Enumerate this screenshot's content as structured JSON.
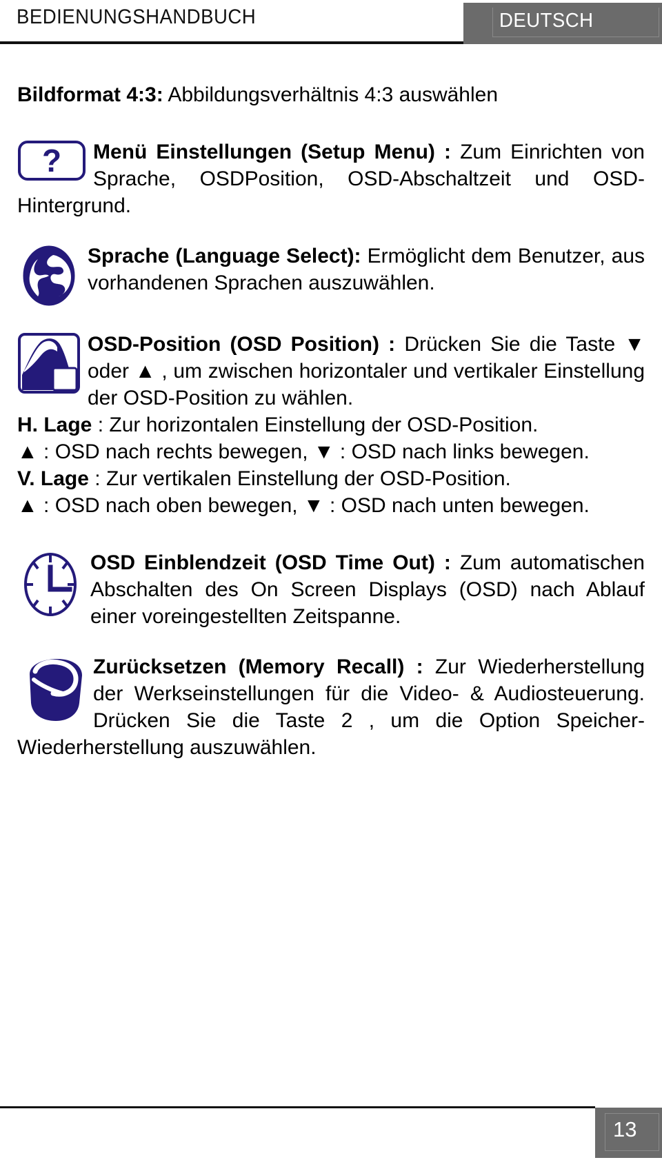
{
  "header": {
    "manual_title": "BEDIENUNGSHANDBUCH",
    "language_badge": "DEUTSCH"
  },
  "footer": {
    "page_number": "13"
  },
  "colors": {
    "icon_navy": "#241a7a",
    "header_gray": "#6b6b6b",
    "rule_black": "#111111",
    "text_black": "#000000"
  },
  "content": {
    "aspect_line": {
      "lead": "Bildformat 4:3:",
      "rest": " Abbildungsverhältnis 4:3 auswählen"
    },
    "setup_menu": {
      "icon": "question-mark-icon",
      "lead": "Menü Einstellungen (Setup Menu)",
      "separator": " : ",
      "body": "Zum Einrichten von Sprache, OSDPosition, OSD-Abschaltzeit und OSD-Hintergrund."
    },
    "language_select": {
      "icon": "globe-icon",
      "lead": "Sprache (Language Select):",
      "body": " Ermöglicht dem Benutzer, aus vorhandenen Sprachen auszuwählen."
    },
    "osd_position": {
      "icon": "osd-position-icon",
      "lead": "OSD-Position (OSD Position)",
      "separator": " : ",
      "body": "Drücken Sie die Taste ▼ oder ▲ , um zwischen horizontaler und vertikaler Einstellung der OSD-Position zu wählen.",
      "h_lage_lead": "H. Lage",
      "h_lage_body": " : Zur horizontalen Einstellung der OSD-Position.",
      "h_lage_keys": "▲ : OSD nach rechts bewegen, ▼ : OSD nach links bewegen.",
      "v_lage_lead": "V. Lage",
      "v_lage_body": " : Zur vertikalen Einstellung der OSD-Position.",
      "v_lage_keys": "▲ : OSD nach oben bewegen, ▼ : OSD nach unten bewegen."
    },
    "osd_time_out": {
      "icon": "clock-icon",
      "lead": "OSD Einblendzeit (OSD Time Out)",
      "separator": " : ",
      "body": "Zum automatischen Abschalten des On Screen Displays (OSD) nach Ablauf einer voreingestellten Zeitspanne."
    },
    "memory_recall": {
      "icon": "bucket-icon",
      "lead": "Zurücksetzen (Memory Recall)",
      "separator": " : ",
      "body": "Zur Wiederherstellung der Werkseinstellungen für die Video- & Audiosteuerung. Drücken Sie die Taste 2 , um die Option Speicher-Wiederherstellung auszuwählen."
    }
  }
}
